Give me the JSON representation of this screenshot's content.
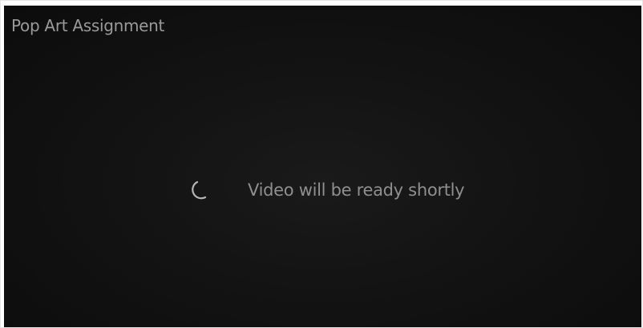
{
  "player": {
    "title": "Pop Art Assignment",
    "status_text": "Video will be ready shortly",
    "spinner_icon": "loading-spinner-icon",
    "colors": {
      "background": "#121212",
      "text": "#8f8f8f",
      "spinner": "#b5b5b5"
    }
  }
}
